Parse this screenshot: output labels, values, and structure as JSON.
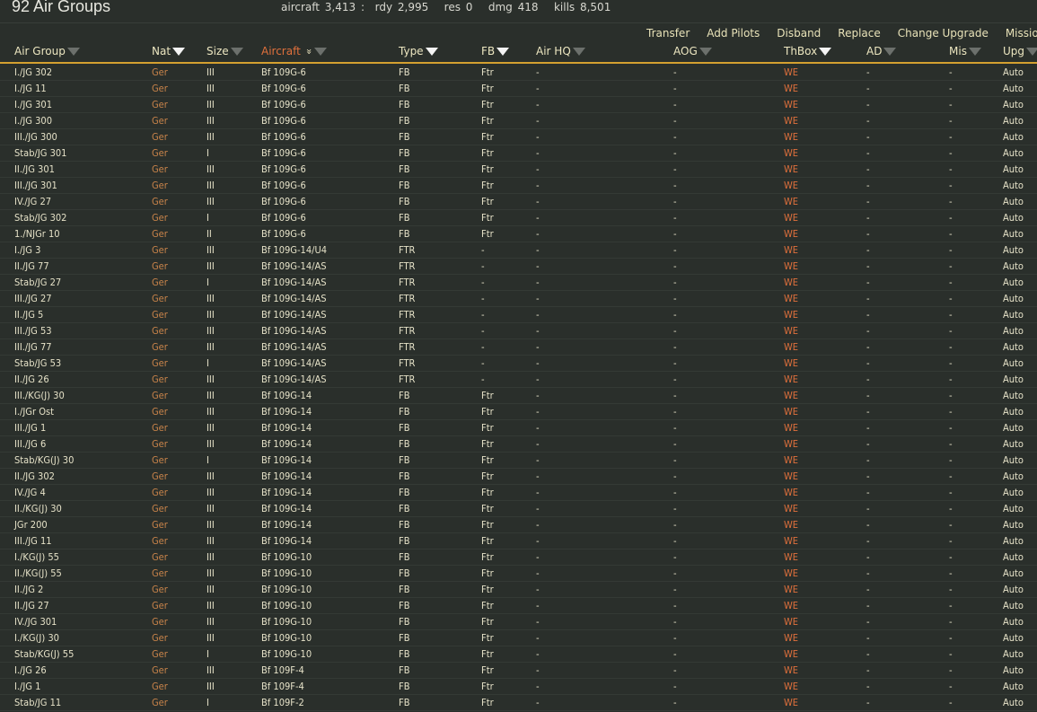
{
  "title": "92 Air Groups",
  "stats": "aircraft 3,413 :  rdy 2,995   res 0   dmg 418   kills 8,501",
  "actions": [
    "Transfer",
    "Add Pilots",
    "Disband",
    "Replace",
    "Change Upgrade",
    "Mission S"
  ],
  "columns": [
    {
      "label": "Air Group",
      "filter": false
    },
    {
      "label": "Nat",
      "filter": true
    },
    {
      "label": "Size",
      "filter": false
    },
    {
      "label": "Aircraft",
      "filter": false,
      "sorted": true
    },
    {
      "label": "Type",
      "filter": true
    },
    {
      "label": "FB",
      "filter": true
    },
    {
      "label": "Air HQ",
      "filter": false
    },
    {
      "label": "AOG",
      "filter": false
    },
    {
      "label": "ThBox",
      "filter": true
    },
    {
      "label": "AD",
      "filter": false
    },
    {
      "label": "Mis",
      "filter": false
    },
    {
      "label": "Upg",
      "filter": false
    }
  ],
  "colors": {
    "accent_line": "#d4a030",
    "nat": "#c9844a",
    "thbox": "#e0703c"
  },
  "rows": [
    [
      "I./JG 302",
      "Ger",
      "III",
      "Bf 109G-6",
      "FB",
      "Ftr",
      "-",
      "-",
      "WE",
      "-",
      "-",
      "Auto"
    ],
    [
      "I./JG 11",
      "Ger",
      "III",
      "Bf 109G-6",
      "FB",
      "Ftr",
      "-",
      "-",
      "WE",
      "-",
      "-",
      "Auto"
    ],
    [
      "I./JG 301",
      "Ger",
      "III",
      "Bf 109G-6",
      "FB",
      "Ftr",
      "-",
      "-",
      "WE",
      "-",
      "-",
      "Auto"
    ],
    [
      "I./JG 300",
      "Ger",
      "III",
      "Bf 109G-6",
      "FB",
      "Ftr",
      "-",
      "-",
      "WE",
      "-",
      "-",
      "Auto"
    ],
    [
      "III./JG 300",
      "Ger",
      "III",
      "Bf 109G-6",
      "FB",
      "Ftr",
      "-",
      "-",
      "WE",
      "-",
      "-",
      "Auto"
    ],
    [
      "Stab/JG 301",
      "Ger",
      "I",
      "Bf 109G-6",
      "FB",
      "Ftr",
      "-",
      "-",
      "WE",
      "-",
      "-",
      "Auto"
    ],
    [
      "II./JG 301",
      "Ger",
      "III",
      "Bf 109G-6",
      "FB",
      "Ftr",
      "-",
      "-",
      "WE",
      "-",
      "-",
      "Auto"
    ],
    [
      "III./JG 301",
      "Ger",
      "III",
      "Bf 109G-6",
      "FB",
      "Ftr",
      "-",
      "-",
      "WE",
      "-",
      "-",
      "Auto"
    ],
    [
      "IV./JG 27",
      "Ger",
      "III",
      "Bf 109G-6",
      "FB",
      "Ftr",
      "-",
      "-",
      "WE",
      "-",
      "-",
      "Auto"
    ],
    [
      "Stab/JG 302",
      "Ger",
      "I",
      "Bf 109G-6",
      "FB",
      "Ftr",
      "-",
      "-",
      "WE",
      "-",
      "-",
      "Auto"
    ],
    [
      "1./NJGr 10",
      "Ger",
      "II",
      "Bf 109G-6",
      "FB",
      "Ftr",
      "-",
      "-",
      "WE",
      "-",
      "-",
      "Auto"
    ],
    [
      "I./JG 3",
      "Ger",
      "III",
      "Bf 109G-14/U4",
      "FTR",
      "-",
      "-",
      "-",
      "WE",
      "-",
      "-",
      "Auto"
    ],
    [
      "II./JG 77",
      "Ger",
      "III",
      "Bf 109G-14/AS",
      "FTR",
      "-",
      "-",
      "-",
      "WE",
      "-",
      "-",
      "Auto"
    ],
    [
      "Stab/JG 27",
      "Ger",
      "I",
      "Bf 109G-14/AS",
      "FTR",
      "-",
      "-",
      "-",
      "WE",
      "-",
      "-",
      "Auto"
    ],
    [
      "III./JG 27",
      "Ger",
      "III",
      "Bf 109G-14/AS",
      "FTR",
      "-",
      "-",
      "-",
      "WE",
      "-",
      "-",
      "Auto"
    ],
    [
      "II./JG 5",
      "Ger",
      "III",
      "Bf 109G-14/AS",
      "FTR",
      "-",
      "-",
      "-",
      "WE",
      "-",
      "-",
      "Auto"
    ],
    [
      "III./JG 53",
      "Ger",
      "III",
      "Bf 109G-14/AS",
      "FTR",
      "-",
      "-",
      "-",
      "WE",
      "-",
      "-",
      "Auto"
    ],
    [
      "III./JG 77",
      "Ger",
      "III",
      "Bf 109G-14/AS",
      "FTR",
      "-",
      "-",
      "-",
      "WE",
      "-",
      "-",
      "Auto"
    ],
    [
      "Stab/JG 53",
      "Ger",
      "I",
      "Bf 109G-14/AS",
      "FTR",
      "-",
      "-",
      "-",
      "WE",
      "-",
      "-",
      "Auto"
    ],
    [
      "II./JG 26",
      "Ger",
      "III",
      "Bf 109G-14/AS",
      "FTR",
      "-",
      "-",
      "-",
      "WE",
      "-",
      "-",
      "Auto"
    ],
    [
      "III./KG(J) 30",
      "Ger",
      "III",
      "Bf 109G-14",
      "FB",
      "Ftr",
      "-",
      "-",
      "WE",
      "-",
      "-",
      "Auto"
    ],
    [
      "I./JGr Ost",
      "Ger",
      "III",
      "Bf 109G-14",
      "FB",
      "Ftr",
      "-",
      "-",
      "WE",
      "-",
      "-",
      "Auto"
    ],
    [
      "III./JG 1",
      "Ger",
      "III",
      "Bf 109G-14",
      "FB",
      "Ftr",
      "-",
      "-",
      "WE",
      "-",
      "-",
      "Auto"
    ],
    [
      "III./JG 6",
      "Ger",
      "III",
      "Bf 109G-14",
      "FB",
      "Ftr",
      "-",
      "-",
      "WE",
      "-",
      "-",
      "Auto"
    ],
    [
      "Stab/KG(J) 30",
      "Ger",
      "I",
      "Bf 109G-14",
      "FB",
      "Ftr",
      "-",
      "-",
      "WE",
      "-",
      "-",
      "Auto"
    ],
    [
      "II./JG 302",
      "Ger",
      "III",
      "Bf 109G-14",
      "FB",
      "Ftr",
      "-",
      "-",
      "WE",
      "-",
      "-",
      "Auto"
    ],
    [
      "IV./JG 4",
      "Ger",
      "III",
      "Bf 109G-14",
      "FB",
      "Ftr",
      "-",
      "-",
      "WE",
      "-",
      "-",
      "Auto"
    ],
    [
      "II./KG(J) 30",
      "Ger",
      "III",
      "Bf 109G-14",
      "FB",
      "Ftr",
      "-",
      "-",
      "WE",
      "-",
      "-",
      "Auto"
    ],
    [
      "JGr 200",
      "Ger",
      "III",
      "Bf 109G-14",
      "FB",
      "Ftr",
      "-",
      "-",
      "WE",
      "-",
      "-",
      "Auto"
    ],
    [
      "III./JG 11",
      "Ger",
      "III",
      "Bf 109G-14",
      "FB",
      "Ftr",
      "-",
      "-",
      "WE",
      "-",
      "-",
      "Auto"
    ],
    [
      "I./KG(J) 55",
      "Ger",
      "III",
      "Bf 109G-10",
      "FB",
      "Ftr",
      "-",
      "-",
      "WE",
      "-",
      "-",
      "Auto"
    ],
    [
      "II./KG(J) 55",
      "Ger",
      "III",
      "Bf 109G-10",
      "FB",
      "Ftr",
      "-",
      "-",
      "WE",
      "-",
      "-",
      "Auto"
    ],
    [
      "II./JG 2",
      "Ger",
      "III",
      "Bf 109G-10",
      "FB",
      "Ftr",
      "-",
      "-",
      "WE",
      "-",
      "-",
      "Auto"
    ],
    [
      "II./JG 27",
      "Ger",
      "III",
      "Bf 109G-10",
      "FB",
      "Ftr",
      "-",
      "-",
      "WE",
      "-",
      "-",
      "Auto"
    ],
    [
      "IV./JG 301",
      "Ger",
      "III",
      "Bf 109G-10",
      "FB",
      "Ftr",
      "-",
      "-",
      "WE",
      "-",
      "-",
      "Auto"
    ],
    [
      "I./KG(J) 30",
      "Ger",
      "III",
      "Bf 109G-10",
      "FB",
      "Ftr",
      "-",
      "-",
      "WE",
      "-",
      "-",
      "Auto"
    ],
    [
      "Stab/KG(J) 55",
      "Ger",
      "I",
      "Bf 109G-10",
      "FB",
      "Ftr",
      "-",
      "-",
      "WE",
      "-",
      "-",
      "Auto"
    ],
    [
      "I./JG 26",
      "Ger",
      "III",
      "Bf 109F-4",
      "FB",
      "Ftr",
      "-",
      "-",
      "WE",
      "-",
      "-",
      "Auto"
    ],
    [
      "I./JG 1",
      "Ger",
      "III",
      "Bf 109F-4",
      "FB",
      "Ftr",
      "-",
      "-",
      "WE",
      "-",
      "-",
      "Auto"
    ],
    [
      "Stab/JG 11",
      "Ger",
      "I",
      "Bf 109F-2",
      "FB",
      "Ftr",
      "-",
      "-",
      "WE",
      "-",
      "-",
      "Auto"
    ]
  ]
}
